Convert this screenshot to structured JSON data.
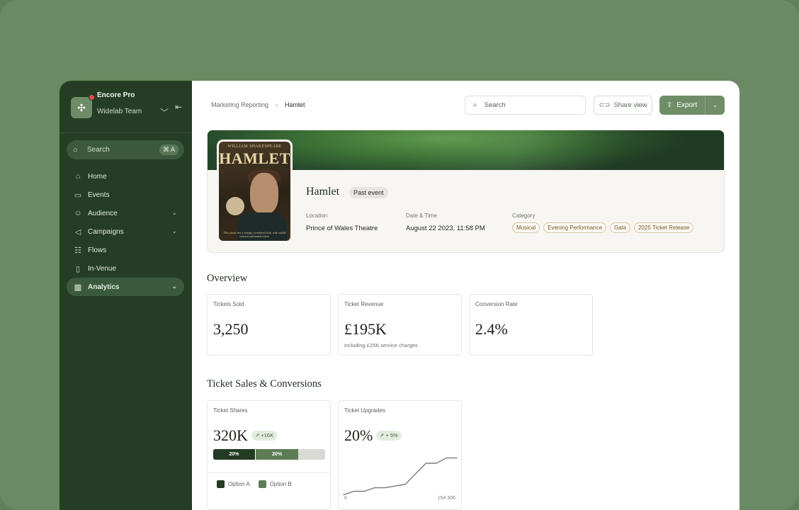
{
  "sidebar": {
    "team_name": "Encore Pro",
    "team_sub": "Widelab Team",
    "search_label": "Search",
    "search_shortcut": "⌘ A",
    "items": [
      {
        "label": "Home",
        "icon": "home-icon"
      },
      {
        "label": "Events",
        "icon": "calendar-icon"
      },
      {
        "label": "Audience",
        "icon": "users-icon"
      },
      {
        "label": "Campaigns",
        "icon": "megaphone-icon"
      },
      {
        "label": "Flows",
        "icon": "flow-icon"
      },
      {
        "label": "In-Venue",
        "icon": "building-icon"
      },
      {
        "label": "Analytics",
        "icon": "chart-icon"
      }
    ]
  },
  "header": {
    "breadcrumb": [
      "Marketing Reporting",
      "Hamlet"
    ],
    "search_placeholder": "Search",
    "share_label": "Share view",
    "export_label": "Export"
  },
  "event": {
    "poster_author": "WILLIAM SHAKESPEARE",
    "poster_title": "HAMLET",
    "poster_tagline": "This classic has a vintage, weathered look, with visible textures and muted colors.",
    "title": "Hamlet",
    "badge": "Past event",
    "location_label": "Location",
    "location": "Prince of Wales Theatre",
    "datetime_label": "Date & Time",
    "datetime": "August 22 2023, 11:58 PM",
    "category_label": "Category",
    "categories": [
      "Musical",
      "Evening Performance",
      "Gala",
      "2025 Ticket Release"
    ]
  },
  "overview": {
    "title": "Overview",
    "cards": [
      {
        "label": "Tickets Sold",
        "value": "3,250",
        "sub": ""
      },
      {
        "label": "Ticket Revenue",
        "value": "£195K",
        "sub": "including £15K service charges"
      },
      {
        "label": "Conversion Rate",
        "value": "2.4%",
        "sub": ""
      }
    ]
  },
  "sales": {
    "title": "Ticket Sales & Conversions",
    "shares": {
      "label": "Ticket Shares",
      "value": "320K",
      "delta": "↗ +16K",
      "segments": [
        {
          "label": "20%",
          "fraction": 0.38
        },
        {
          "label": "20%",
          "fraction": 0.38
        }
      ],
      "legend": [
        "Option A",
        "Option B"
      ],
      "colors": [
        "#233a23",
        "#5d7c56"
      ]
    },
    "upgrades": {
      "label": "Ticket Upgrades",
      "value": "20%",
      "delta": "↗ + 5%",
      "axis_start": "0",
      "axis_end": "154 306"
    }
  },
  "chart_data": {
    "type": "line",
    "title": "Ticket Upgrades",
    "xlabel": "",
    "ylabel": "",
    "x_tick_labels": [
      "0",
      "154 306"
    ],
    "series": [
      {
        "values": [
          2,
          6,
          6,
          10,
          10,
          12,
          14,
          26,
          38,
          38,
          44,
          44
        ]
      }
    ],
    "ylim": [
      0,
      46
    ],
    "grid": false
  }
}
